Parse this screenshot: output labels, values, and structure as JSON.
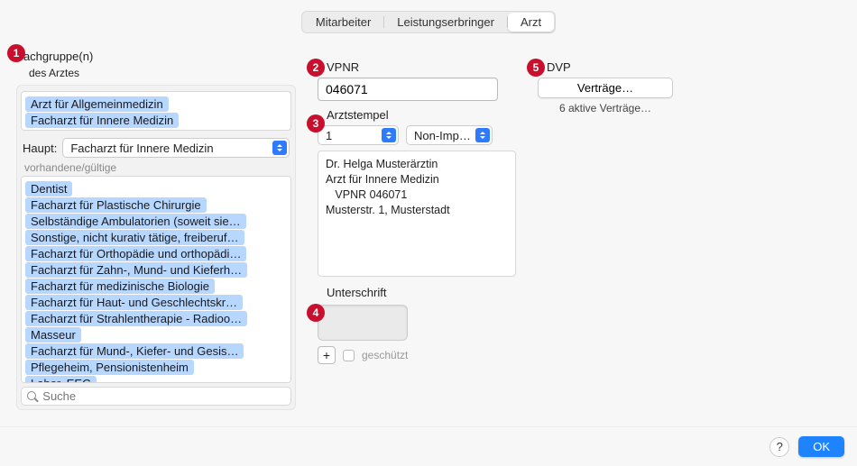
{
  "tabs": {
    "items": [
      "Mitarbeiter",
      "Leistungserbringer",
      "Arzt"
    ],
    "active": 2
  },
  "badges": [
    "1",
    "2",
    "3",
    "4",
    "5"
  ],
  "fachgruppen": {
    "label": "Fachgruppe(n)",
    "sublabel": "des Arztes",
    "assigned": [
      "Arzt für Allgemeinmedizin",
      "Facharzt für Innere Medizin"
    ],
    "haupt_label": "Haupt:",
    "haupt_value": "Facharzt für Innere Medizin",
    "available_header": "vorhandene/gültige",
    "available": [
      "Dentist",
      "Facharzt für Plastische Chirurgie",
      "Selbständige Ambulatorien (soweit sie…",
      "Sonstige, nicht kurativ tätige, freiberuf…",
      "Facharzt für Orthopädie und orthopädi…",
      "Facharzt für Zahn-, Mund- und Kieferh…",
      "Facharzt für medizinische Biologie",
      "Facharzt für Haut- und Geschlechtskr…",
      "Facharzt für Strahlentherapie - Radioo…",
      "Masseur",
      "Facharzt für Mund-, Kiefer- und Gesis…",
      "Pflegeheim, Pensionistenheim",
      "Labor, EEG"
    ],
    "search_placeholder": "Suche"
  },
  "vpnr": {
    "label": "VPNR",
    "value": "046071"
  },
  "arztstempel": {
    "label": "Arztstempel",
    "slot": "1",
    "type": "Non-Imp…",
    "lines": [
      "Dr. Helga Musterärztin",
      "Arzt für Innere Medizin",
      "   VPNR 046071",
      "Musterstr. 1, Musterstadt"
    ]
  },
  "unterschrift": {
    "label": "Unterschrift",
    "protected": "geschützt"
  },
  "dvp": {
    "label": "DVP",
    "button": "Verträge…",
    "status": "6 aktive Verträge…"
  },
  "footer": {
    "ok": "OK",
    "help": "?"
  }
}
